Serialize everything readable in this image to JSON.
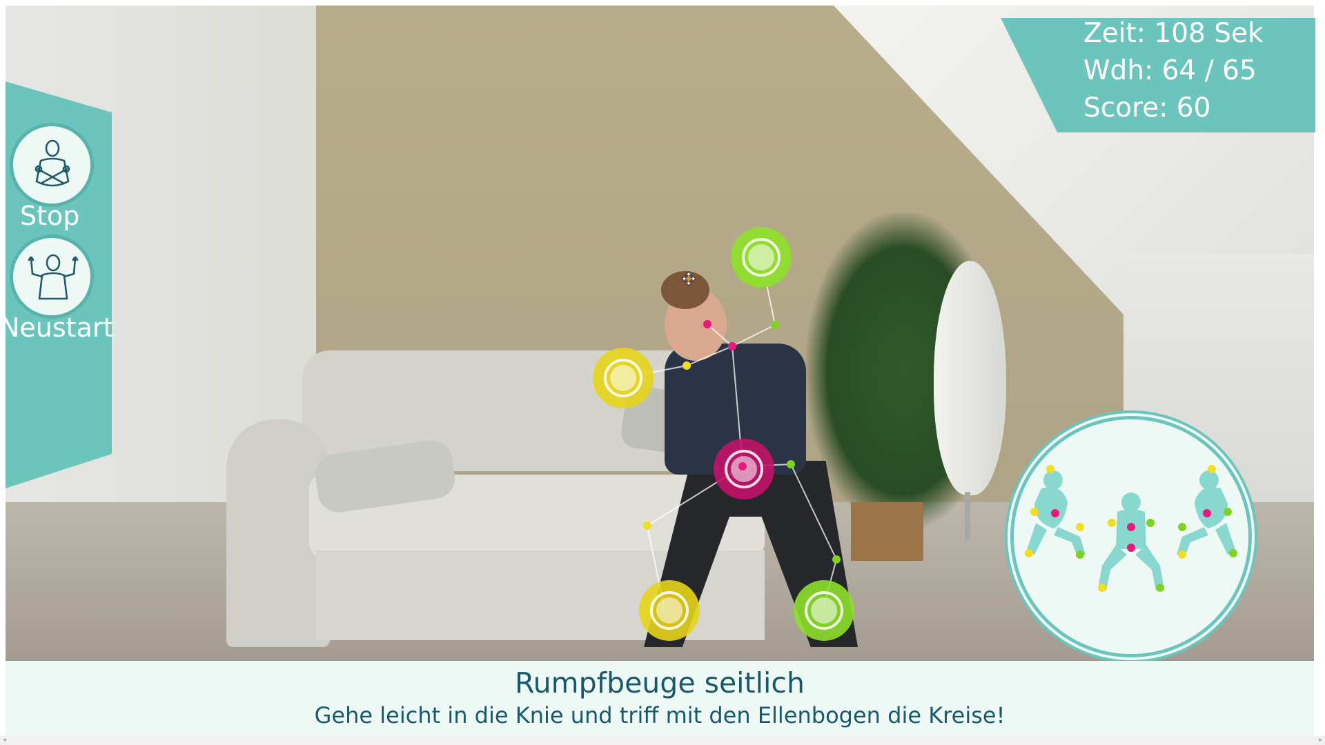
{
  "controls": {
    "stop_label": "Stop",
    "restart_label": "Neustart"
  },
  "stats": {
    "time": "Zeit: 108 Sek",
    "reps": "Wdh: 64 / 65",
    "score": "Score: 60"
  },
  "exercise": {
    "title": "Rumpfbeuge seitlich",
    "instruction": "Gehe leicht in die Knie und triff mit den Ellenbogen die Kreise!"
  },
  "colors": {
    "accent": "#6cc5bd",
    "panel_light": "#eef9f6",
    "text_dark": "#17586a",
    "target_green": "#8ee02a",
    "target_yellow": "#e6d41a",
    "target_magenta": "#c4126a",
    "joint_pink": "#e8197a",
    "joint_yellow": "#f2de21",
    "joint_green": "#7ed321"
  },
  "icons": {
    "stop": "arms-crossed-person-icon",
    "restart": "arms-raised-person-icon",
    "cursor": "move-cursor-icon"
  }
}
